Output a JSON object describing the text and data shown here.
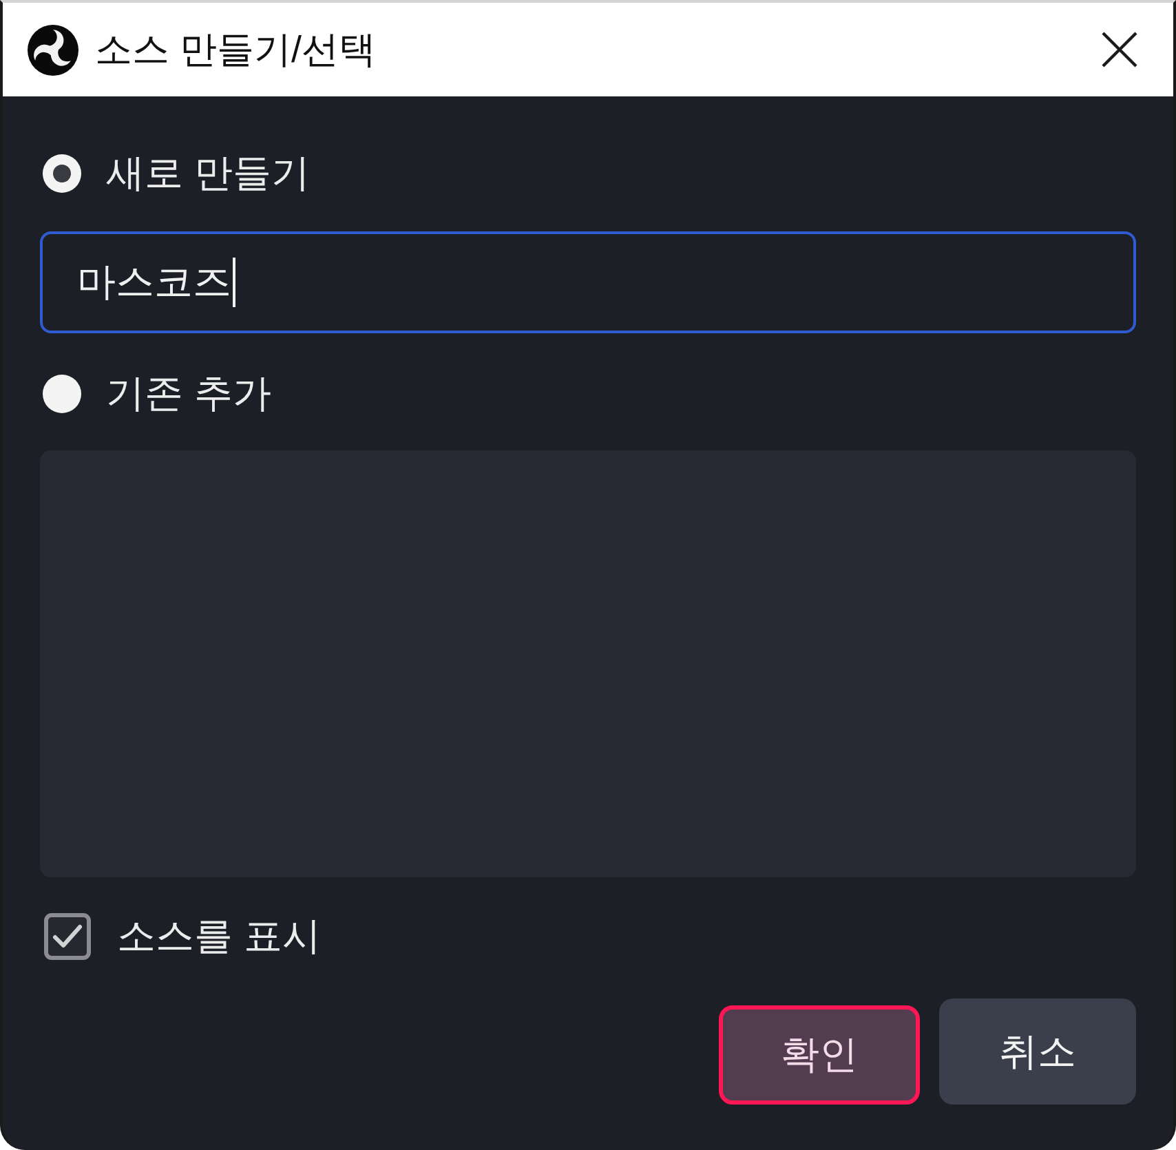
{
  "window": {
    "title": "소스 만들기/선택"
  },
  "options": [
    {
      "label": "새로 만들기",
      "selected": true
    },
    {
      "label": "기존 추가",
      "selected": false
    }
  ],
  "name_field": {
    "value": "마스코즈"
  },
  "show_source": {
    "label": "소스를 표시",
    "checked": true
  },
  "buttons": [
    {
      "label": "확인",
      "focused": true
    },
    {
      "label": "취소",
      "focused": false
    }
  ]
}
